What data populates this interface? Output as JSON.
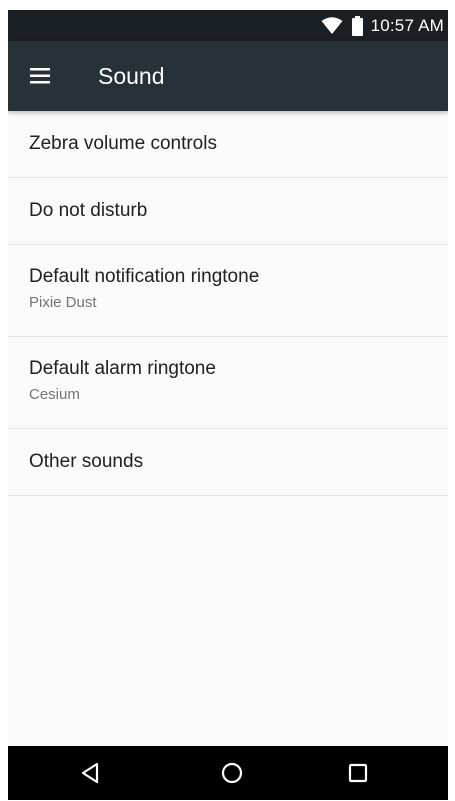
{
  "status_bar": {
    "time": "10:57 AM",
    "icons": [
      "wifi-icon",
      "battery-icon"
    ]
  },
  "app_bar": {
    "title": "Sound",
    "menu_icon": "hamburger-menu-icon"
  },
  "settings": {
    "items": [
      {
        "title": "Zebra volume controls"
      },
      {
        "title": "Do not disturb"
      },
      {
        "title": "Default notification ringtone",
        "summary": "Pixie Dust"
      },
      {
        "title": "Default alarm ringtone",
        "summary": "Cesium"
      },
      {
        "title": "Other sounds"
      }
    ]
  },
  "nav_bar": {
    "buttons": [
      "back-icon",
      "home-icon",
      "recents-icon"
    ]
  },
  "colors": {
    "status_bar": "#1a1f23",
    "app_bar": "#263238",
    "background": "#fafafa",
    "primary_text": "#212121",
    "secondary_text": "#757575",
    "nav_bar": "#000000"
  }
}
